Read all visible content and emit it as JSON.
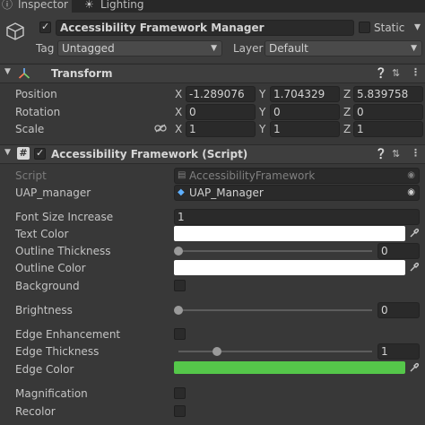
{
  "tabs": {
    "inspector": "Inspector",
    "lighting": "Lighting"
  },
  "object": {
    "name": "Accessibility Framework Manager",
    "static_label": "Static",
    "tag_label": "Tag",
    "tag_value": "Untagged",
    "layer_label": "Layer",
    "layer_value": "Default"
  },
  "transform": {
    "title": "Transform",
    "position_label": "Position",
    "rotation_label": "Rotation",
    "scale_label": "Scale",
    "axis_x": "X",
    "axis_y": "Y",
    "axis_z": "Z",
    "position": {
      "x": "-1.289076",
      "y": "1.704329",
      "z": "5.839758"
    },
    "rotation": {
      "x": "0",
      "y": "0",
      "z": "0"
    },
    "scale": {
      "x": "1",
      "y": "1",
      "z": "1"
    }
  },
  "component": {
    "title": "Accessibility Framework (Script)",
    "script_label": "Script",
    "script_value": "AccessibilityFramework",
    "uap_label": "UAP_manager",
    "uap_value": "UAP_Manager",
    "font_size_label": "Font Size Increase",
    "font_size_value": "1",
    "text_color_label": "Text Color",
    "outline_thickness_label": "Outline Thickness",
    "outline_thickness_value": "0",
    "outline_thickness_level": 0.0,
    "outline_color_label": "Outline Color",
    "background_label": "Background",
    "brightness_label": "Brightness",
    "brightness_value": "0",
    "brightness_level": 0.0,
    "edge_enh_label": "Edge Enhancement",
    "edge_thickness_label": "Edge Thickness",
    "edge_thickness_value": "1",
    "edge_thickness_level": 0.2,
    "edge_color_label": "Edge Color",
    "magnification_label": "Magnification",
    "recolor_label": "Recolor"
  },
  "colors": {
    "text_color": "#ffffff",
    "outline_color": "#ffffff",
    "edge_color": "#55c74a",
    "accent": "#4a8be0"
  },
  "icons": {
    "gameobject": "cube-icon",
    "transform": "transform-axes-icon",
    "script": "csharp-script-icon",
    "help": "help-icon",
    "presets": "sliders-icon",
    "menu": "kebab-icon",
    "picker": "eyedropper-icon",
    "link": "link-icon"
  }
}
